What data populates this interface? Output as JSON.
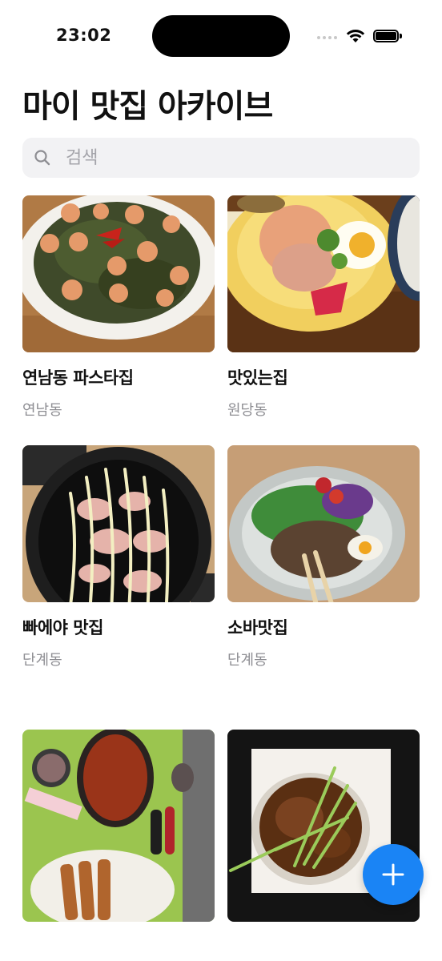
{
  "status_bar": {
    "time": "23:02"
  },
  "header": {
    "title": "마이 맛집 아카이브"
  },
  "search": {
    "placeholder": "검색",
    "value": ""
  },
  "restaurants": [
    {
      "name": "연남동 파스타집",
      "area": "연남동"
    },
    {
      "name": "맛있는집",
      "area": "원당동"
    },
    {
      "name": "빠에야 맛집",
      "area": "단계동"
    },
    {
      "name": "소바맛집",
      "area": "단계동"
    },
    {
      "name": "",
      "area": ""
    },
    {
      "name": "",
      "area": ""
    }
  ],
  "fab": {
    "icon": "plus-icon",
    "color": "#1a84f5"
  },
  "colors": {
    "accent": "#1a84f5",
    "secondary_text": "#8e8e93",
    "search_bg": "#f2f2f4"
  }
}
